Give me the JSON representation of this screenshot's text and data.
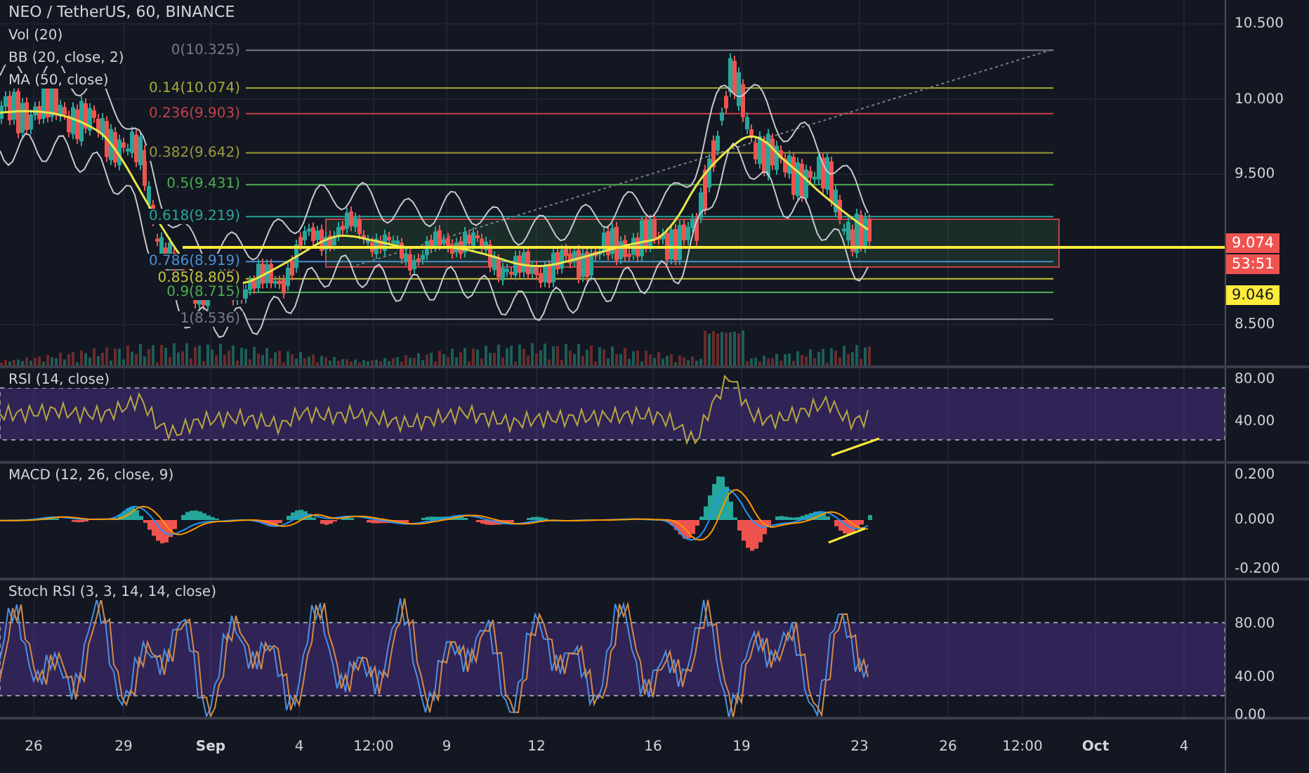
{
  "chart": {
    "title": "NEO / TetherUS, 60, BINANCE",
    "legends": [
      "Vol (20)",
      "BB (20, close, 2)",
      "MA (50, close)"
    ],
    "fib_levels": [
      {
        "label": "0(10.325)",
        "color": "#787b86"
      },
      {
        "label": "0.14(10.074)",
        "color": "#a8ab34"
      },
      {
        "label": "0.236(9.903)",
        "color": "#c4414a"
      },
      {
        "label": "0.382(9.642)",
        "color": "#9a9a3a"
      },
      {
        "label": "0.5(9.431)",
        "color": "#4caf50"
      },
      {
        "label": "0.618(9.219)",
        "color": "#26a69a"
      },
      {
        "label": "0.786(8.919)",
        "color": "#4c8fd6"
      },
      {
        "label": "0.85(8.805)",
        "color": "#c7c73a"
      },
      {
        "label": "0.9(8.715)",
        "color": "#4caf50"
      },
      {
        "label": "1(8.536)",
        "color": "#787b86"
      }
    ],
    "price_axis": [
      "10.500",
      "10.000",
      "9.500",
      "8.500"
    ],
    "price_tags": [
      {
        "text": "9.074",
        "kind": "last"
      },
      {
        "text": "53:51",
        "kind": "countdown"
      },
      {
        "text": "9.046",
        "kind": "ma"
      }
    ]
  },
  "panes": [
    {
      "kind": "rsi",
      "legend": "RSI (14, close)",
      "axis": [
        "80.00",
        "40.00"
      ]
    },
    {
      "kind": "macd",
      "legend": "MACD (12, 26, close, 9)",
      "axis": [
        "0.200",
        "0.000",
        "-0.200"
      ]
    },
    {
      "kind": "stoch",
      "legend": "Stoch RSI (3, 3, 14, 14, close)",
      "axis": [
        "80.00",
        "40.00",
        "0.00"
      ]
    }
  ],
  "time_axis": [
    {
      "label": "26",
      "kind": "day"
    },
    {
      "label": "29",
      "kind": "day"
    },
    {
      "label": "Sep",
      "kind": "month"
    },
    {
      "label": "4",
      "kind": "day"
    },
    {
      "label": "12:00",
      "kind": "day"
    },
    {
      "label": "9",
      "kind": "day"
    },
    {
      "label": "12",
      "kind": "day"
    },
    {
      "label": "16",
      "kind": "day"
    },
    {
      "label": "19",
      "kind": "day"
    },
    {
      "label": "23",
      "kind": "day"
    },
    {
      "label": "26",
      "kind": "day"
    },
    {
      "label": "12:00",
      "kind": "day"
    },
    {
      "label": "Oct",
      "kind": "month"
    },
    {
      "label": "4",
      "kind": "day"
    }
  ]
}
